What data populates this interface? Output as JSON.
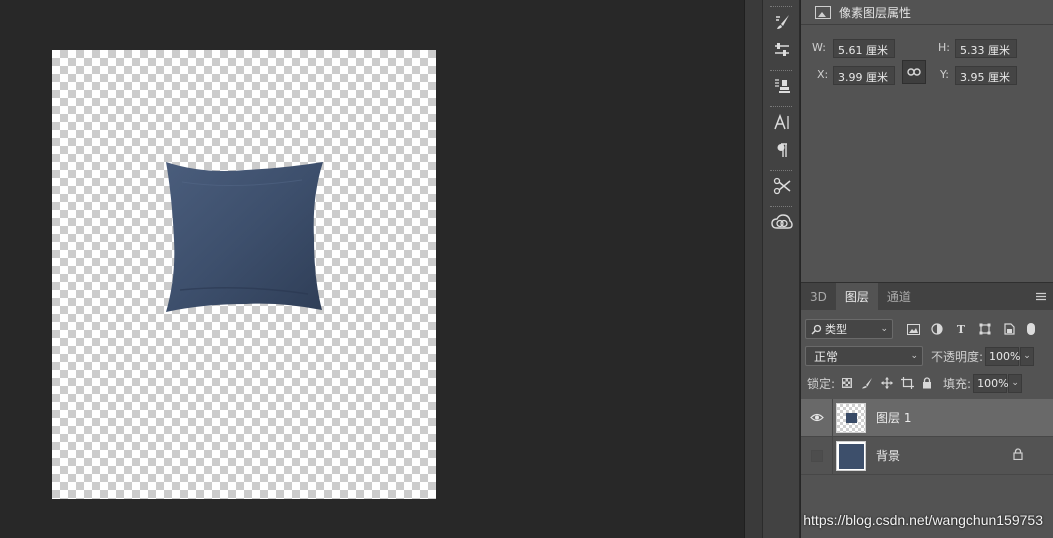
{
  "properties": {
    "title": "像素图层属性",
    "w_label": "W:",
    "w_value": "5.61 厘米",
    "h_label": "H:",
    "h_value": "5.33 厘米",
    "x_label": "X:",
    "x_value": "3.99 厘米",
    "y_label": "Y:",
    "y_value": "3.95 厘米"
  },
  "layers_panel": {
    "tabs": [
      {
        "label": "3D"
      },
      {
        "label": "图层"
      },
      {
        "label": "通道"
      }
    ],
    "active_tab": "图层",
    "filter_label": "类型",
    "blend_mode": "正常",
    "opacity_label": "不透明度:",
    "opacity_value": "100%",
    "lock_label": "锁定:",
    "fill_label": "填充:",
    "fill_value": "100%",
    "layers": [
      {
        "name": "图层 1",
        "visible": true,
        "selected": true,
        "locked": false
      },
      {
        "name": "背景",
        "visible": false,
        "selected": false,
        "locked": true
      }
    ]
  },
  "icons": {
    "strip": [
      "brush-presets-icon",
      "adjust-sliders-icon",
      "clone-source-icon",
      "character-icon",
      "paragraph-icon",
      "tool-presets-icon",
      "creative-cloud-icon"
    ],
    "filter": [
      "pixel-filter-icon",
      "adjustment-filter-icon",
      "type-filter-icon",
      "shape-filter-icon",
      "smart-object-filter-icon"
    ],
    "lock": [
      "lock-transparent-icon",
      "lock-image-icon",
      "lock-position-icon",
      "lock-artboard-icon",
      "lock-all-icon"
    ]
  },
  "colors": {
    "pillow": "#3b4c68",
    "panel_bg": "#535353",
    "selected_layer": "#696969"
  },
  "watermark": "https://blog.csdn.net/wangchun159753"
}
